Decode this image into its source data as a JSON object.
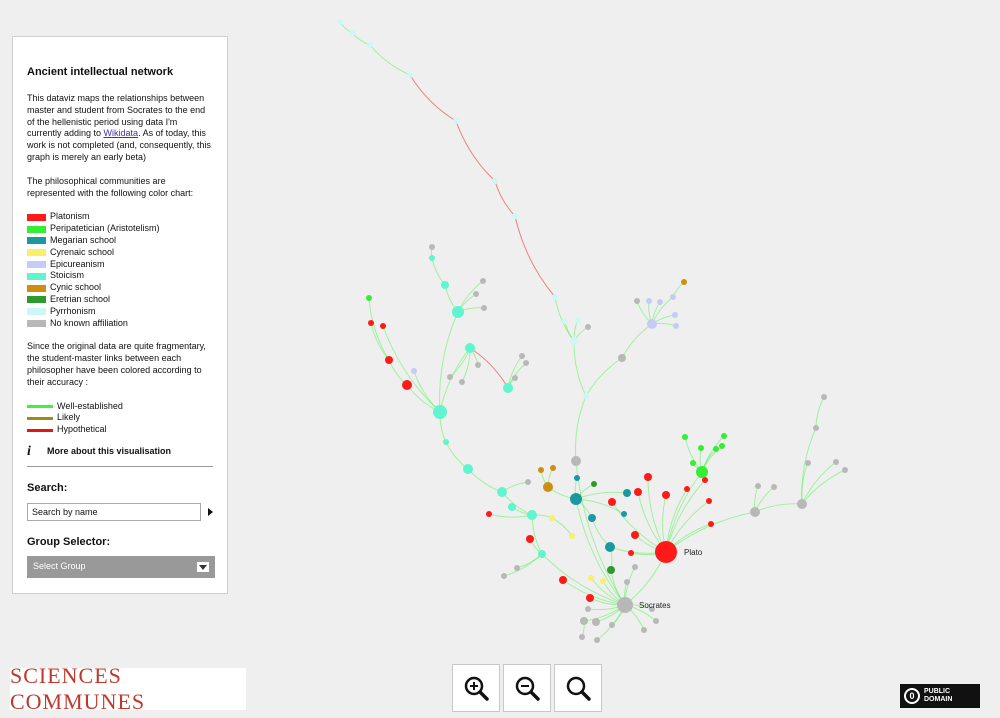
{
  "panel": {
    "title": "Ancient intellectual network",
    "intro_before_link": "This dataviz maps the relationships between master and student from Socrates to the end of the hellenistic period using data I'm currently adding to ",
    "intro_link": "Wikidata",
    "intro_after_link": ". As of today, this work is not completed (and, consequently, this graph is merely an early beta)",
    "color_chart_text": "The philosophical communities are represented with the following color chart:",
    "communities": [
      {
        "label": "Platonism",
        "color": "#ff1a1a"
      },
      {
        "label": "Peripatetician (Aristotelism)",
        "color": "#33ee33"
      },
      {
        "label": "Megarian school",
        "color": "#1a9aa0"
      },
      {
        "label": "Cyrenaic school",
        "color": "#f9ef6a"
      },
      {
        "label": "Epicureanism",
        "color": "#c5cbf5"
      },
      {
        "label": "Stoicism",
        "color": "#5ef5d0"
      },
      {
        "label": "Cynic school",
        "color": "#cc8f10"
      },
      {
        "label": "Eretrian school",
        "color": "#2e9a2e"
      },
      {
        "label": "Pyrrhonism",
        "color": "#cdf7f7"
      },
      {
        "label": "No known affiliation",
        "color": "#b8b8b8"
      }
    ],
    "accuracy_text": "Since the original data are quite fragmentary, the student-master links between each philosopher have been colored according to their accuracy :",
    "link_types": [
      {
        "label": "Well-established",
        "color": "#3ef33e"
      },
      {
        "label": "Likely",
        "color": "#9a8a1a"
      },
      {
        "label": "Hypothetical",
        "color": "#ee1111"
      }
    ],
    "more_info": "More about this visualisation",
    "search_heading": "Search:",
    "search_placeholder": "Search by name",
    "group_heading": "Group Selector:",
    "group_value": "Select Group"
  },
  "graph": {
    "labels": {
      "plato": "Plato",
      "socrates": "Socrates"
    }
  },
  "footer": {
    "logo_text": "SCIENCES COMMUNES",
    "license_line1": "PUBLIC",
    "license_line2": "DOMAIN",
    "license_symbol": "0"
  }
}
